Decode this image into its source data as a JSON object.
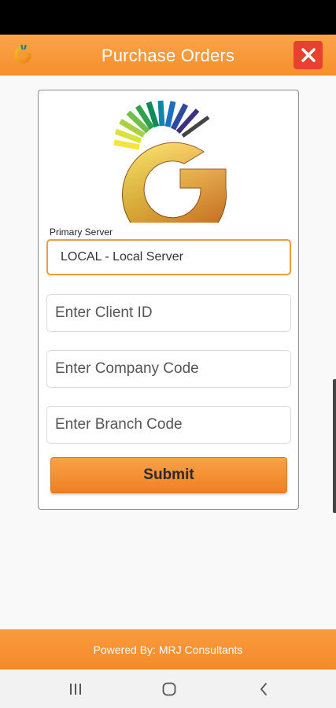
{
  "app": {
    "title": "Purchase Orders"
  },
  "form": {
    "server_label": "Primary Server",
    "server_value": "LOCAL - Local Server",
    "client_id_placeholder": "Enter Client ID",
    "company_code_placeholder": "Enter Company Code",
    "branch_code_placeholder": "Enter Branch Code",
    "submit_label": "Submit"
  },
  "footer": {
    "text": "Powered By: MRJ Consultants"
  },
  "icons": {
    "close": "close-icon",
    "recents": "recents-icon",
    "home": "home-icon",
    "back": "back-icon"
  },
  "colors": {
    "accent": "#f7962f",
    "close_red": "#e8412f",
    "status_bar": "#000000"
  }
}
